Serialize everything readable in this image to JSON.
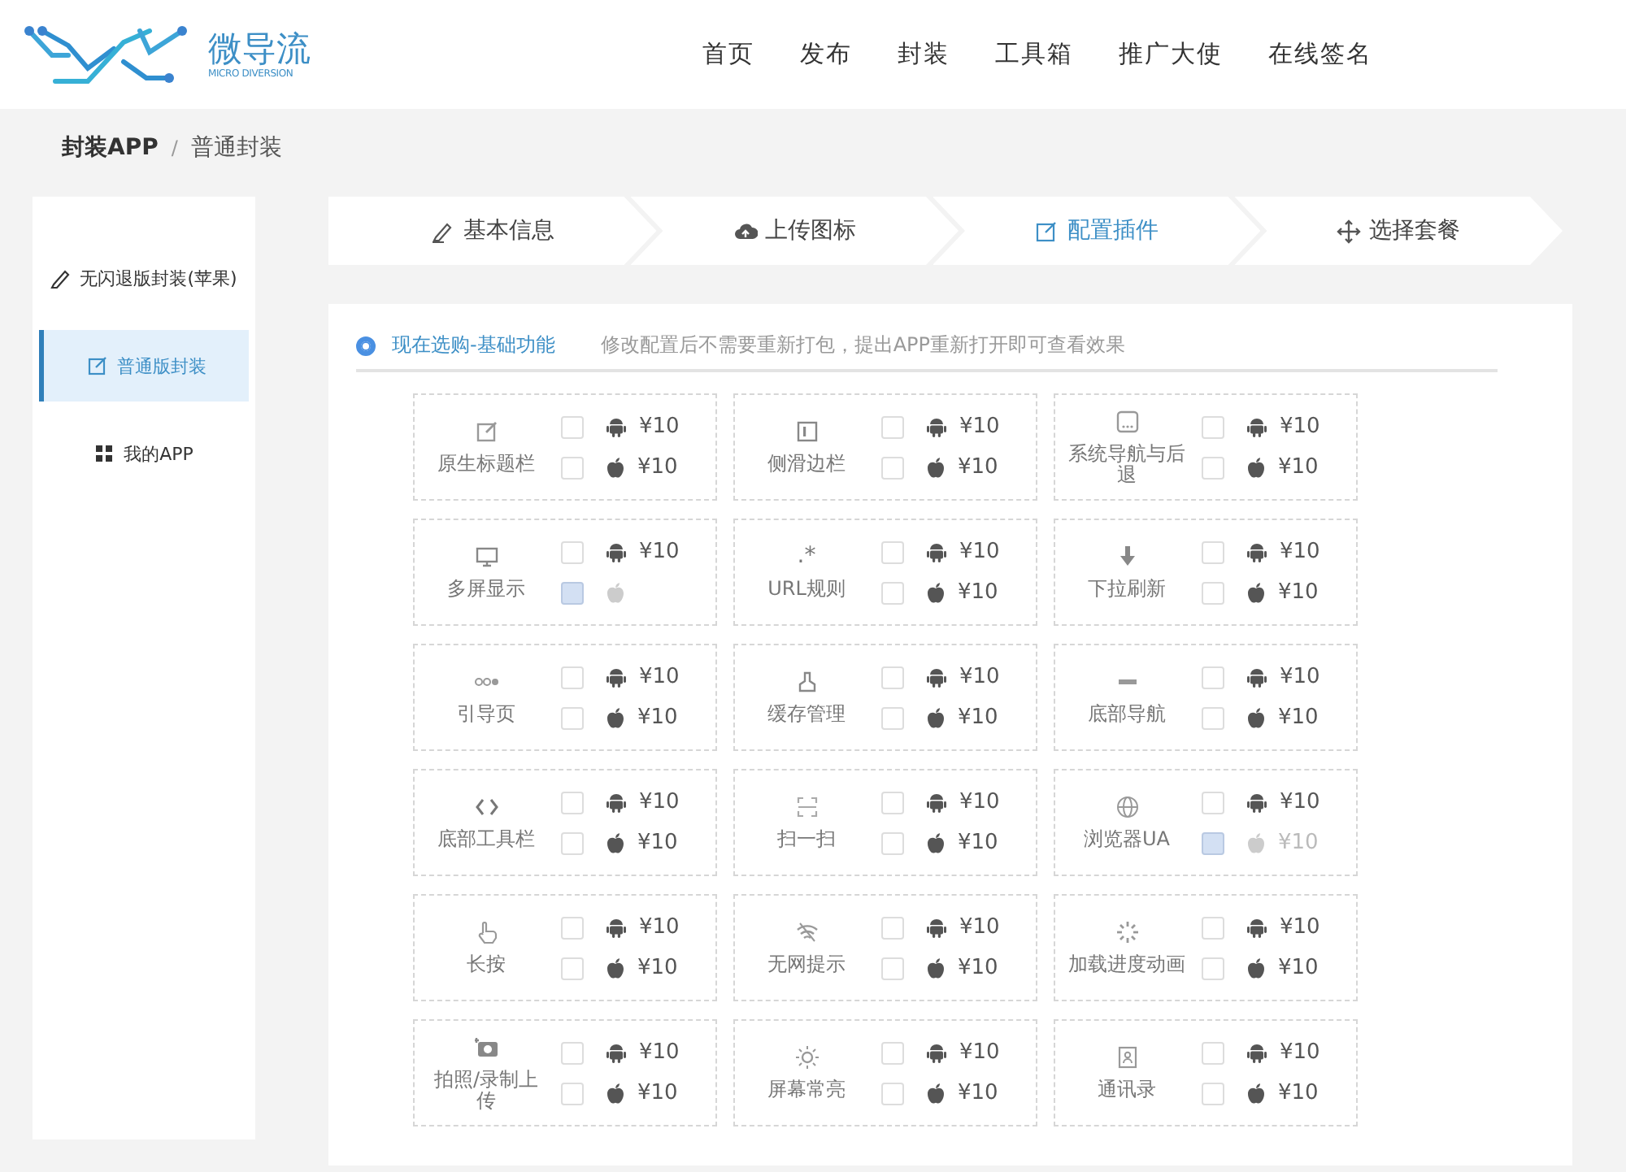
{
  "header": {
    "logo": {
      "name": "微导流",
      "subtitle": "MICRO DIVERSION"
    },
    "nav": [
      {
        "label": "首页"
      },
      {
        "label": "发布"
      },
      {
        "label": "封装"
      },
      {
        "label": "工具箱"
      },
      {
        "label": "推广大使"
      },
      {
        "label": "在线签名"
      }
    ]
  },
  "breadcrumb": [
    {
      "label": "封装APP"
    },
    {
      "label": "/"
    },
    {
      "label": "普通封装"
    }
  ],
  "sidebar": {
    "items": [
      {
        "label": "无闪退版封装(苹果)",
        "selected": false
      },
      {
        "label": "普通版封装",
        "selected": true
      },
      {
        "label": "我的APP",
        "selected": false
      }
    ]
  },
  "steps": [
    {
      "label": "基本信息",
      "selected": false
    },
    {
      "label": "上传图标",
      "selected": false
    },
    {
      "label": "配置插件",
      "selected": true
    },
    {
      "label": "选择套餐",
      "selected": false
    }
  ],
  "section": {
    "title": "现在选购-基础功能",
    "selected": true,
    "hint": "修改配置后不需要重新打包，提出APP重新打开即可查看效果"
  },
  "features": [
    {
      "name": "原生标题栏",
      "android": {
        "price": "¥10",
        "checked": false,
        "disabled": false
      },
      "ios": {
        "price": "¥10",
        "checked": false,
        "disabled": false
      }
    },
    {
      "name": "侧滑边栏",
      "android": {
        "price": "¥10",
        "checked": false,
        "disabled": false
      },
      "ios": {
        "price": "¥10",
        "checked": false,
        "disabled": false
      }
    },
    {
      "name": "系统导航与后退",
      "android": {
        "price": "¥10",
        "checked": false,
        "disabled": false
      },
      "ios": {
        "price": "¥10",
        "checked": false,
        "disabled": false
      }
    },
    {
      "name": "多屏显示",
      "android": {
        "price": "¥10",
        "checked": false,
        "disabled": false
      },
      "ios": {
        "checked": false,
        "disabled": true
      }
    },
    {
      "name": "URL规则",
      "icon_text": ".*",
      "android": {
        "price": "¥10",
        "checked": false,
        "disabled": false
      },
      "ios": {
        "price": "¥10",
        "checked": false,
        "disabled": false
      }
    },
    {
      "name": "下拉刷新",
      "android": {
        "price": "¥10",
        "checked": false,
        "disabled": false
      },
      "ios": {
        "price": "¥10",
        "checked": false,
        "disabled": false
      }
    },
    {
      "name": "引导页",
      "android": {
        "price": "¥10",
        "checked": false,
        "disabled": false
      },
      "ios": {
        "price": "¥10",
        "checked": false,
        "disabled": false
      }
    },
    {
      "name": "缓存管理",
      "android": {
        "price": "¥10",
        "checked": false,
        "disabled": false
      },
      "ios": {
        "price": "¥10",
        "checked": false,
        "disabled": false
      }
    },
    {
      "name": "底部导航",
      "android": {
        "price": "¥10",
        "checked": false,
        "disabled": false
      },
      "ios": {
        "price": "¥10",
        "checked": false,
        "disabled": false
      }
    },
    {
      "name": "底部工具栏",
      "android": {
        "price": "¥10",
        "checked": false,
        "disabled": false
      },
      "ios": {
        "price": "¥10",
        "checked": false,
        "disabled": false
      }
    },
    {
      "name": "扫一扫",
      "android": {
        "price": "¥10",
        "checked": false,
        "disabled": false
      },
      "ios": {
        "price": "¥10",
        "checked": false,
        "disabled": false
      }
    },
    {
      "name": "浏览器UA",
      "android": {
        "price": "¥10",
        "checked": false,
        "disabled": false
      },
      "ios": {
        "price": "¥10",
        "checked": false,
        "disabled": true
      }
    },
    {
      "name": "长按",
      "android": {
        "price": "¥10",
        "checked": false,
        "disabled": false
      },
      "ios": {
        "price": "¥10",
        "checked": false,
        "disabled": false
      }
    },
    {
      "name": "无网提示",
      "android": {
        "price": "¥10",
        "checked": false,
        "disabled": false
      },
      "ios": {
        "price": "¥10",
        "checked": false,
        "disabled": false
      }
    },
    {
      "name": "加载进度动画",
      "android": {
        "price": "¥10",
        "checked": false,
        "disabled": false
      },
      "ios": {
        "price": "¥10",
        "checked": false,
        "disabled": false
      }
    },
    {
      "name": "拍照/录制上传",
      "android": {
        "price": "¥10",
        "checked": false,
        "disabled": false
      },
      "ios": {
        "price": "¥10",
        "checked": false,
        "disabled": false
      }
    },
    {
      "name": "屏幕常亮",
      "android": {
        "price": "¥10",
        "checked": false,
        "disabled": false
      },
      "ios": {
        "price": "¥10",
        "checked": false,
        "disabled": false
      }
    },
    {
      "name": "通讯录",
      "android": {
        "price": "¥10",
        "checked": false,
        "disabled": false
      },
      "ios": {
        "price": "¥10",
        "checked": false,
        "disabled": false
      }
    }
  ]
}
